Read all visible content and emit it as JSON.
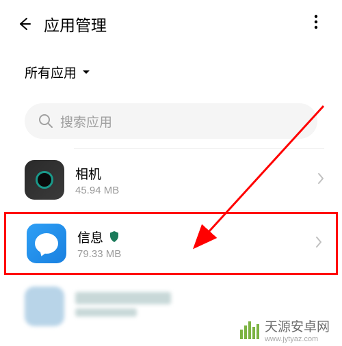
{
  "header": {
    "title": "应用管理"
  },
  "filter": {
    "label": "所有应用"
  },
  "search": {
    "placeholder": "搜索应用"
  },
  "apps": [
    {
      "name": "相机",
      "size": "45.94 MB",
      "has_shield": false
    },
    {
      "name": "信息",
      "size": "79.33 MB",
      "has_shield": true
    }
  ],
  "watermark": {
    "text": "天源安卓网",
    "url": "www.jytyaz.com"
  },
  "colors": {
    "highlight_border": "#ff0000",
    "annotation_arrow": "#ff0000",
    "shield": "#1a7a5a"
  }
}
